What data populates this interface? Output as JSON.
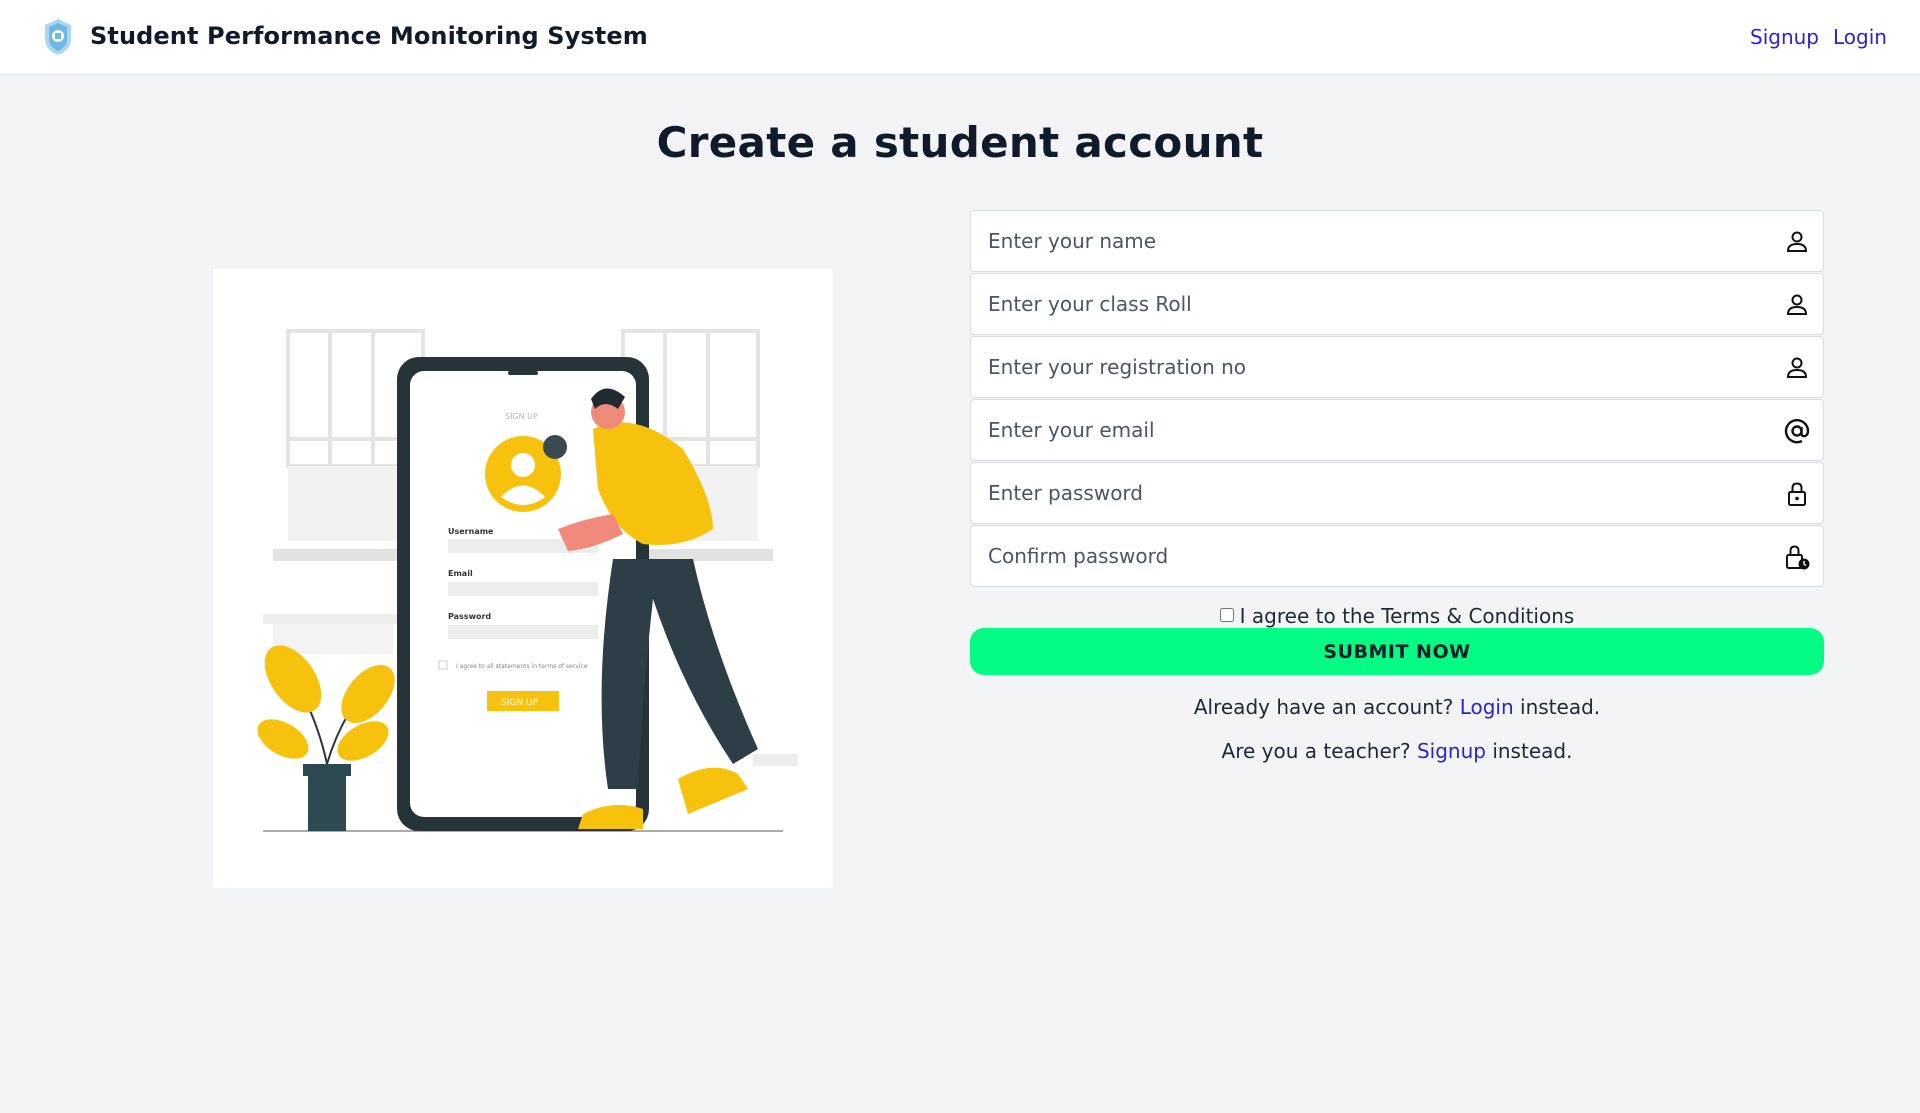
{
  "header": {
    "title": "Student Performance Monitoring System",
    "nav_signup": "Signup",
    "nav_login": "Login"
  },
  "page": {
    "heading": "Create a student account"
  },
  "illustration": {
    "screen_title": "SIGN UP",
    "username_label": "Username",
    "email_label": "Email",
    "password_label": "Password",
    "agree_text": "I agree to all statements in terms of service",
    "button_label": "SIGN UP"
  },
  "form": {
    "fields": [
      {
        "placeholder": "Enter your name",
        "icon": "user-icon"
      },
      {
        "placeholder": "Enter your class Roll",
        "icon": "user-icon"
      },
      {
        "placeholder": "Enter your registration no",
        "icon": "user-icon"
      },
      {
        "placeholder": "Enter your email",
        "icon": "at-icon"
      },
      {
        "placeholder": "Enter password",
        "icon": "lock-icon"
      },
      {
        "placeholder": "Confirm password",
        "icon": "lock-clock-icon"
      }
    ],
    "terms_label": "I agree to the Terms & Conditions",
    "submit_label": "SUBMIT NOW",
    "login_prompt": "Already have an account?",
    "login_link": "Login",
    "login_suffix": "instead.",
    "teacher_prompt": "Are you a teacher?",
    "teacher_link": "Signup",
    "teacher_suffix": "instead."
  },
  "colors": {
    "accent_link": "#2a24c9",
    "submit_bg": "#04fc84",
    "illustration_yellow": "#f7c20e",
    "illustration_dark": "#2d3e46"
  }
}
